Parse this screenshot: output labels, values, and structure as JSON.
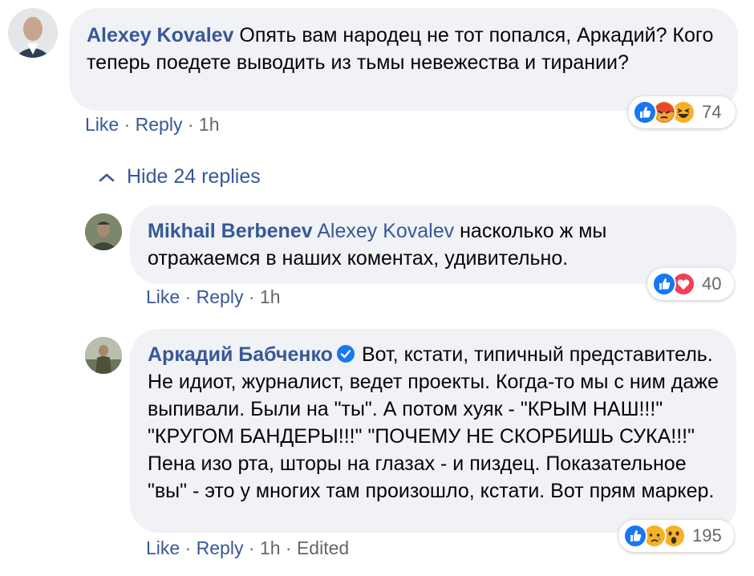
{
  "comment": {
    "author": "Alexey Kovalev",
    "text": "Опять вам народец не тот попался, Аркадий? Кого теперь поедете выводить из тьмы невежества и тирании?",
    "like_label": "Like",
    "reply_label": "Reply",
    "time": "1h",
    "reactions": [
      "like-icon",
      "angry-icon",
      "haha-icon"
    ],
    "reaction_count": "74"
  },
  "hide_replies_label": "Hide 24 replies",
  "replies": [
    {
      "author": "Mikhail Berbenev",
      "mention": "Alexey Kovalev",
      "text": "насколько ж мы отражаемся в наших коментах, удивительно.",
      "like_label": "Like",
      "reply_label": "Reply",
      "time": "1h",
      "reactions": [
        "like-icon",
        "love-icon"
      ],
      "reaction_count": "40"
    },
    {
      "author": "Аркадий Бабченко",
      "verified": true,
      "text": "Вот, кстати, типичный представитель. Не идиот, журналист, ведет проекты. Когда-то мы с ним даже выпивали. Были на \"ты\". А потом хуяк - \"КРЫМ НАШ!!!\" \"КРУГОМ БАНДЕРЫ!!!\" \"ПОЧЕМУ НЕ СКОРБИШЬ СУКА!!!\" Пена изо рта, шторы на глазах - и пиздец. Показательное \"вы\" - это у многих там произошло, кстати. Вот прям маркер.",
      "like_label": "Like",
      "reply_label": "Reply",
      "time": "1h",
      "edited_label": "Edited",
      "reactions": [
        "like-icon",
        "sad-icon",
        "wow-icon"
      ],
      "reaction_count": "195"
    }
  ],
  "separator": "·",
  "colors": {
    "link": "#385898",
    "meta_text": "#65676b",
    "bubble_bg": "#f0f2f5",
    "like_blue": "#1877f2",
    "love_red": "#f33e58",
    "yellow": "#f7b125"
  }
}
